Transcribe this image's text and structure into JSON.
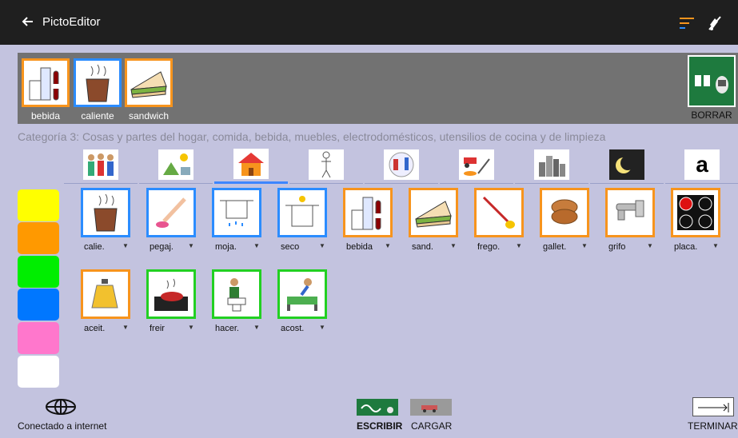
{
  "app": {
    "title": "PictoEditor"
  },
  "phrase": [
    {
      "label": "bebida",
      "icon": "drinks-icon",
      "border": "orange"
    },
    {
      "label": "caliente",
      "icon": "hot-drink-icon",
      "border": "blue"
    },
    {
      "label": "sandwich",
      "icon": "sandwich-icon",
      "border": "orange"
    }
  ],
  "borrar_label": "BORRAR",
  "category_text": "Categoría 3: Cosas y partes del hogar, comida, bebida, muebles, electrodomésticos, utensilios de cocina y de limpieza",
  "category_tabs": [
    {
      "icon": "people-icon"
    },
    {
      "icon": "nature-icon"
    },
    {
      "icon": "house-icon",
      "active": true
    },
    {
      "icon": "body-icon"
    },
    {
      "icon": "tools-icon"
    },
    {
      "icon": "vehicles-icon"
    },
    {
      "icon": "city-icon"
    },
    {
      "icon": "night-icon"
    },
    {
      "letter": "a"
    }
  ],
  "colors": {
    "swatches": [
      "#ffff00",
      "#ff9900",
      "#00ee00",
      "#0077ff",
      "#ff77cc",
      "#ffffff"
    ],
    "blue": "#2b8cff",
    "orange": "#f7941d",
    "green": "#22d022"
  },
  "pictograms": [
    {
      "label": "calie.",
      "border": "blue",
      "icon": "hot-drink-icon"
    },
    {
      "label": "pegaj.",
      "border": "blue",
      "icon": "sticky-icon"
    },
    {
      "label": "moja.",
      "border": "blue",
      "icon": "wet-cloth-icon"
    },
    {
      "label": "seco",
      "border": "blue",
      "icon": "dry-cloth-icon"
    },
    {
      "label": "bebida",
      "border": "orange",
      "icon": "drinks-icon"
    },
    {
      "label": "sand.",
      "border": "orange",
      "icon": "sandwich-icon"
    },
    {
      "label": "frego.",
      "border": "orange",
      "icon": "mop-icon"
    },
    {
      "label": "gallet.",
      "border": "orange",
      "icon": "cookies-icon"
    },
    {
      "label": "grifo",
      "border": "orange",
      "icon": "faucet-icon"
    },
    {
      "label": "placa.",
      "border": "orange",
      "icon": "cooktop-icon"
    },
    {
      "label": "aceit.",
      "border": "orange",
      "icon": "oil-icon"
    },
    {
      "label": "freir",
      "border": "green",
      "icon": "frying-icon"
    },
    {
      "label": "hacer.",
      "border": "green",
      "icon": "toilet-icon"
    },
    {
      "label": "acost.",
      "border": "green",
      "icon": "bed-icon"
    }
  ],
  "footer": {
    "connection": "Conectado a internet",
    "write": "ESCRIBIR",
    "load": "CARGAR",
    "finish": "TERMINAR"
  }
}
